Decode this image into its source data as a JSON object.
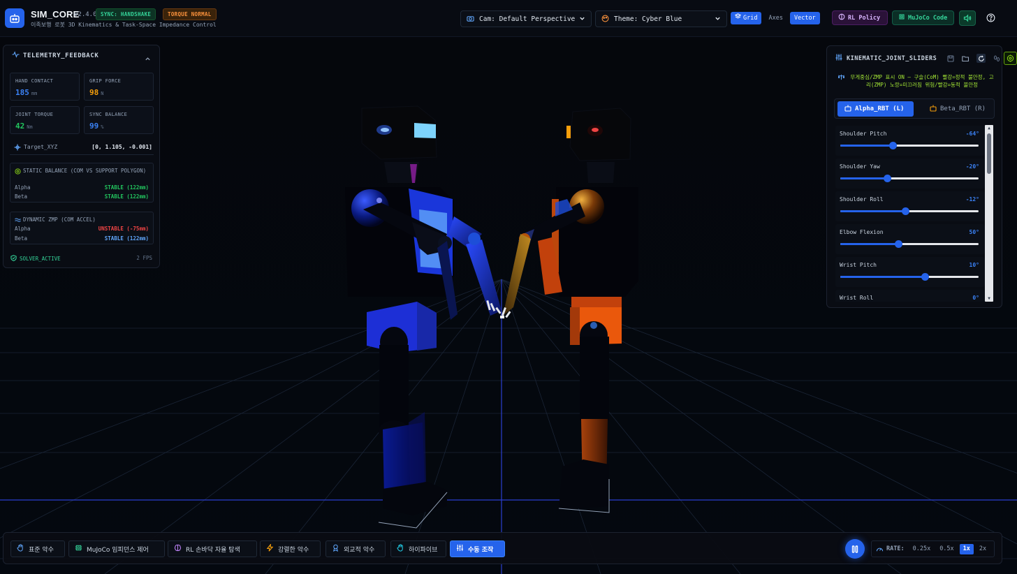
{
  "header": {
    "app_title": "SIM_CORE",
    "version": "v2.4.0",
    "sync_badge": "SYNC: HANDSHAKE",
    "torque_badge": "TORQUE NORMAL",
    "subtitle": "이족보행 로봇 3D Kinematics & Task-Space Impedance Control",
    "camera_select": "Cam: Default Perspective",
    "theme_select": "Theme: Cyber Blue",
    "toggles": {
      "grid": "Grid",
      "axes": "Axes",
      "vector": "Vector"
    },
    "toggle_state": {
      "grid": true,
      "axes": false,
      "vector": true
    },
    "rl_policy": "RL Policy",
    "mujoco_code": "MuJoCo Code",
    "icons": [
      "robot-icon",
      "camera-icon",
      "palette-icon",
      "layers-icon",
      "brain-icon",
      "cpu-icon",
      "speaker-icon",
      "help-icon"
    ]
  },
  "telemetry": {
    "title": "TELEMETRY_FEEDBACK",
    "cells": [
      {
        "label": "HAND CONTACT",
        "value": "185",
        "unit": "mm",
        "color": "#3b82f6"
      },
      {
        "label": "GRIP FORCE",
        "value": "98",
        "unit": "N",
        "color": "#f59e0b"
      },
      {
        "label": "JOINT TORQUE",
        "value": "42",
        "unit": "Nm",
        "color": "#22c55e"
      },
      {
        "label": "SYNC BALANCE",
        "value": "99",
        "unit": "%",
        "color": "#3b82f6"
      }
    ],
    "target_label": "Target_XYZ",
    "target_value": "[0, 1.105, -0.001]",
    "static_balance": {
      "title": "STATIC BALANCE (COM VS SUPPORT POLYGON)",
      "alpha_label": "Alpha",
      "alpha_value": "STABLE (122mm)",
      "beta_label": "Beta",
      "beta_value": "STABLE (122mm)"
    },
    "dynamic_zmp": {
      "title": "DYNAMIC ZMP (COM ACCEL)",
      "alpha_label": "Alpha",
      "alpha_value": "UNSTABLE (-75mm)",
      "beta_label": "Beta",
      "beta_value": "STABLE (122mm)"
    },
    "solver": "SOLVER_ACTIVE",
    "fps": "2 FPS"
  },
  "kinematic": {
    "title": "KINEMATIC_JOINT_SLIDERS",
    "note": "무게중심/ZMP 표시 ON — 구슬(CoM) 빨강=정적 불안정, 고리(ZMP) 노랑=미끄러짐 위험/빨강=동적 불안정",
    "tab_alpha": "Alpha_RBT (L)",
    "tab_beta": "Beta_RBT (R)",
    "sliders": [
      {
        "name": "Shoulder Pitch",
        "value": "-64°",
        "fraction": 0.38
      },
      {
        "name": "Shoulder Yaw",
        "value": "-20°",
        "fraction": 0.34
      },
      {
        "name": "Shoulder Roll",
        "value": "-12°",
        "fraction": 0.47
      },
      {
        "name": "Elbow Flexion",
        "value": "50°",
        "fraction": 0.42
      },
      {
        "name": "Wrist Pitch",
        "value": "10°",
        "fraction": 0.61
      },
      {
        "name": "Wrist Roll",
        "value": "0°",
        "fraction": 0.5
      }
    ]
  },
  "bottom": {
    "modes": [
      "표준 악수",
      "MuJoCo 임피던스 제어",
      "RL 손바닥 자율 탐색",
      "강렬한 악수",
      "외교적 악수",
      "하이파이브",
      "수동 조작"
    ],
    "active_mode": "수동 조작",
    "rate_label": "RATE:",
    "rates": [
      "0.25x",
      "0.5x",
      "1x",
      "2x"
    ],
    "active_rate": "1x"
  },
  "colors": {
    "accent": "#2563eb",
    "alpha_robot": "#1d4ed8",
    "beta_robot": "#c2410c",
    "stable": "#22c55e",
    "unstable": "#ef4444"
  }
}
